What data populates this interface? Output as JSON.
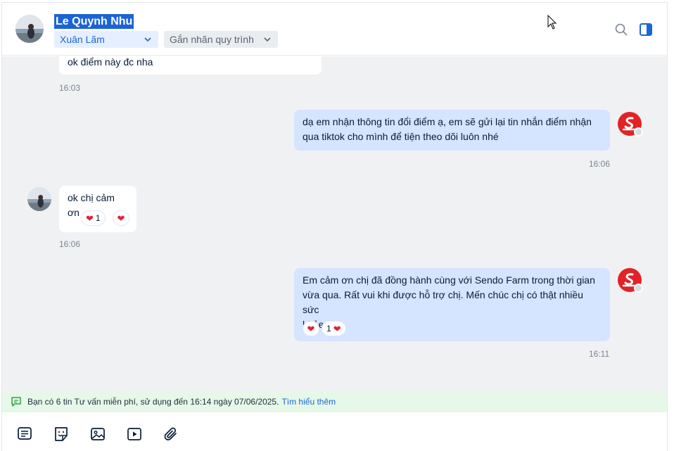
{
  "header": {
    "contact_name": "Le Quynh Nhu",
    "assignee": "Xuân Lãm",
    "label_placeholder": "Gắn nhãn quy trình"
  },
  "messages": [
    {
      "side": "in",
      "text": "ok điểm này đc nha",
      "time": "16:03"
    },
    {
      "side": "out",
      "text_lines": [
        "dạ em nhận thông tin đổi điểm ạ, em sẽ gửi lại tin nhắn điểm nhận",
        "qua tiktok cho mình để tiện theo dõi luôn nhé"
      ],
      "time": "16:06"
    },
    {
      "side": "in",
      "text": "ok chị cảm ơn",
      "reaction_count": "1",
      "time": "16:06"
    },
    {
      "side": "out",
      "text_lines": [
        "Em cảm ơn chị đã đồng hành cùng với Sendo Farm trong thời gian",
        "vừa qua. Rất vui khi được hỗ trợ chị. Mến chúc chị có thật nhiều sức",
        "khỏe."
      ],
      "reaction_count": "1",
      "time": "16:11"
    }
  ],
  "notice": {
    "text": "Bạn có 6 tin Tư vấn miễn phí, sử dụng đến 16:14 ngày 07/06/2025.",
    "link": "Tìm hiểu thêm"
  },
  "toolbar": {
    "icons": [
      "quick-message-icon",
      "sticker-icon",
      "image-icon",
      "video-icon",
      "attach-icon"
    ]
  },
  "colors": {
    "accent": "#1a66d6",
    "incoming_bubble": "#ffffff",
    "outgoing_bubble": "#d5e4ff",
    "chat_bg": "#f0f1f3",
    "notice_bg": "#e6f8e8",
    "brand_red": "#e32226",
    "heart": "#e3203b"
  }
}
